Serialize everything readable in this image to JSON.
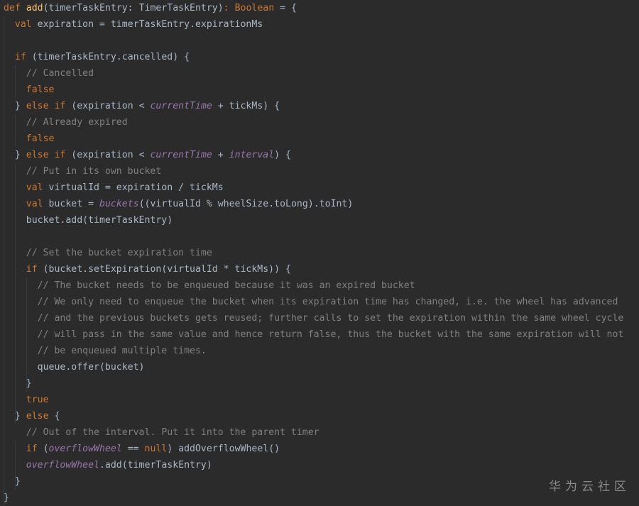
{
  "code": {
    "lines": [
      [
        {
          "t": "def ",
          "c": "kw"
        },
        {
          "t": "add",
          "c": "fn"
        },
        {
          "t": "(timerTaskEntry: TimerTaskEntry)",
          "c": "pl"
        },
        {
          "t": ": ",
          "c": "kw"
        },
        {
          "t": "Boolean ",
          "c": "kw"
        },
        {
          "t": "= {",
          "c": "pl"
        }
      ],
      [
        {
          "t": "  ",
          "c": "pl"
        },
        {
          "t": "val ",
          "c": "kw"
        },
        {
          "t": "expiration = timerTaskEntry.expirationMs",
          "c": "pl"
        }
      ],
      [],
      [
        {
          "t": "  ",
          "c": "pl"
        },
        {
          "t": "if ",
          "c": "kw"
        },
        {
          "t": "(timerTaskEntry.cancelled) {",
          "c": "pl"
        }
      ],
      [
        {
          "t": "    ",
          "c": "pl"
        },
        {
          "t": "// Cancelled",
          "c": "cm"
        }
      ],
      [
        {
          "t": "    ",
          "c": "pl"
        },
        {
          "t": "false",
          "c": "kw"
        }
      ],
      [
        {
          "t": "  } ",
          "c": "pl"
        },
        {
          "t": "else if ",
          "c": "kw"
        },
        {
          "t": "(expiration < ",
          "c": "pl"
        },
        {
          "t": "currentTime",
          "c": "it"
        },
        {
          "t": " + tickMs) {",
          "c": "pl"
        }
      ],
      [
        {
          "t": "    ",
          "c": "pl"
        },
        {
          "t": "// Already expired",
          "c": "cm"
        }
      ],
      [
        {
          "t": "    ",
          "c": "pl"
        },
        {
          "t": "false",
          "c": "kw"
        }
      ],
      [
        {
          "t": "  } ",
          "c": "pl"
        },
        {
          "t": "else if ",
          "c": "kw"
        },
        {
          "t": "(expiration < ",
          "c": "pl"
        },
        {
          "t": "currentTime",
          "c": "it"
        },
        {
          "t": " + ",
          "c": "pl"
        },
        {
          "t": "interval",
          "c": "it"
        },
        {
          "t": ") {",
          "c": "pl"
        }
      ],
      [
        {
          "t": "    ",
          "c": "pl"
        },
        {
          "t": "// Put in its own bucket",
          "c": "cm"
        }
      ],
      [
        {
          "t": "    ",
          "c": "pl"
        },
        {
          "t": "val ",
          "c": "kw"
        },
        {
          "t": "virtualId = expiration / tickMs",
          "c": "pl"
        }
      ],
      [
        {
          "t": "    ",
          "c": "pl"
        },
        {
          "t": "val ",
          "c": "kw"
        },
        {
          "t": "bucket = ",
          "c": "pl"
        },
        {
          "t": "buckets",
          "c": "it"
        },
        {
          "t": "((virtualId % wheelSize.toLong).toInt)",
          "c": "pl"
        }
      ],
      [
        {
          "t": "    bucket.add(timerTaskEntry)",
          "c": "pl"
        }
      ],
      [],
      [
        {
          "t": "    ",
          "c": "pl"
        },
        {
          "t": "// Set the bucket expiration time",
          "c": "cm"
        }
      ],
      [
        {
          "t": "    ",
          "c": "pl"
        },
        {
          "t": "if ",
          "c": "kw"
        },
        {
          "t": "(bucket.setExpiration(virtualId * tickMs)) {",
          "c": "pl"
        }
      ],
      [
        {
          "t": "      ",
          "c": "pl"
        },
        {
          "t": "// The bucket needs to be enqueued because it was an expired bucket",
          "c": "cm"
        }
      ],
      [
        {
          "t": "      ",
          "c": "pl"
        },
        {
          "t": "// We only need to enqueue the bucket when its expiration time has changed, i.e. the wheel has advanced",
          "c": "cm"
        }
      ],
      [
        {
          "t": "      ",
          "c": "pl"
        },
        {
          "t": "// and the previous buckets gets reused; further calls to set the expiration within the same wheel cycle",
          "c": "cm"
        }
      ],
      [
        {
          "t": "      ",
          "c": "pl"
        },
        {
          "t": "// will pass in the same value and hence return false, thus the bucket with the same expiration will not",
          "c": "cm"
        }
      ],
      [
        {
          "t": "      ",
          "c": "pl"
        },
        {
          "t": "// be enqueued multiple times.",
          "c": "cm"
        }
      ],
      [
        {
          "t": "      queue.offer(bucket)",
          "c": "pl"
        }
      ],
      [
        {
          "t": "    }",
          "c": "pl"
        }
      ],
      [
        {
          "t": "    ",
          "c": "pl"
        },
        {
          "t": "true",
          "c": "kw"
        }
      ],
      [
        {
          "t": "  } ",
          "c": "pl"
        },
        {
          "t": "else ",
          "c": "kw"
        },
        {
          "t": "{",
          "c": "pl"
        }
      ],
      [
        {
          "t": "    ",
          "c": "pl"
        },
        {
          "t": "// Out of the interval. Put it into the parent timer",
          "c": "cm"
        }
      ],
      [
        {
          "t": "    ",
          "c": "pl"
        },
        {
          "t": "if ",
          "c": "kw"
        },
        {
          "t": "(",
          "c": "pl"
        },
        {
          "t": "overflowWheel",
          "c": "it"
        },
        {
          "t": " == ",
          "c": "pl"
        },
        {
          "t": "null",
          "c": "kw"
        },
        {
          "t": ") addOverflowWheel()",
          "c": "pl"
        }
      ],
      [
        {
          "t": "    ",
          "c": "pl"
        },
        {
          "t": "overflowWheel",
          "c": "it"
        },
        {
          "t": ".add(timerTaskEntry)",
          "c": "pl"
        }
      ],
      [
        {
          "t": "  }",
          "c": "pl"
        }
      ],
      [
        {
          "t": "}",
          "c": "pl"
        }
      ]
    ]
  },
  "watermark": {
    "text": "华为云社区"
  },
  "colors": {
    "background": "#2b2b2b",
    "plain": "#a9b7c6",
    "keyword": "#cc7832",
    "function": "#ffc66d",
    "comment": "#808080",
    "field": "#9876aa"
  }
}
